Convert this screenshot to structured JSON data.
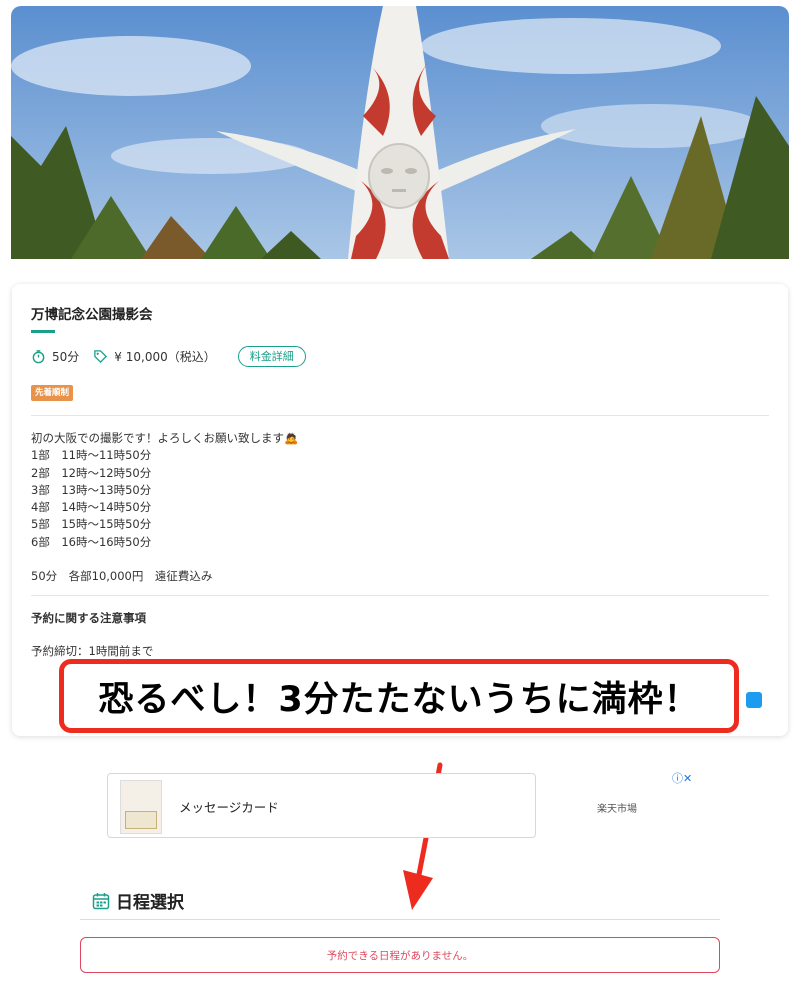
{
  "event": {
    "title": "万博記念公園撮影会",
    "duration": "50分",
    "price": "¥ 10,000（税込）",
    "price_detail_button": "料金詳細",
    "badge": "先着順制",
    "description_lines": [
      "初の大阪での撮影です！よろしくお願い致します🙇",
      "1部　11時〜11時50分",
      "2部　12時〜12時50分",
      "3部　13時〜13時50分",
      "4部　14時〜14時50分",
      "5部　15時〜15時50分",
      "6部　16時〜16時50分",
      "",
      "50分　各部10,000円　遠征費込み"
    ],
    "notes_heading": "予約に関する注意事項",
    "deadline": "予約締切：1時間前まで"
  },
  "annotation": {
    "callout_text": "恐るべし！3分たたないうちに満枠！"
  },
  "ad": {
    "title": "メッセージカード",
    "merchant": "楽天市場",
    "info_icon": "ⓘ✕"
  },
  "schedule": {
    "heading": "日程選択",
    "empty_message": "予約できる日程がありません。"
  },
  "colors": {
    "accent": "#1aa08a",
    "badge": "#e8924a",
    "callout_border": "#ee2b1f",
    "alert": "#e0485e"
  }
}
